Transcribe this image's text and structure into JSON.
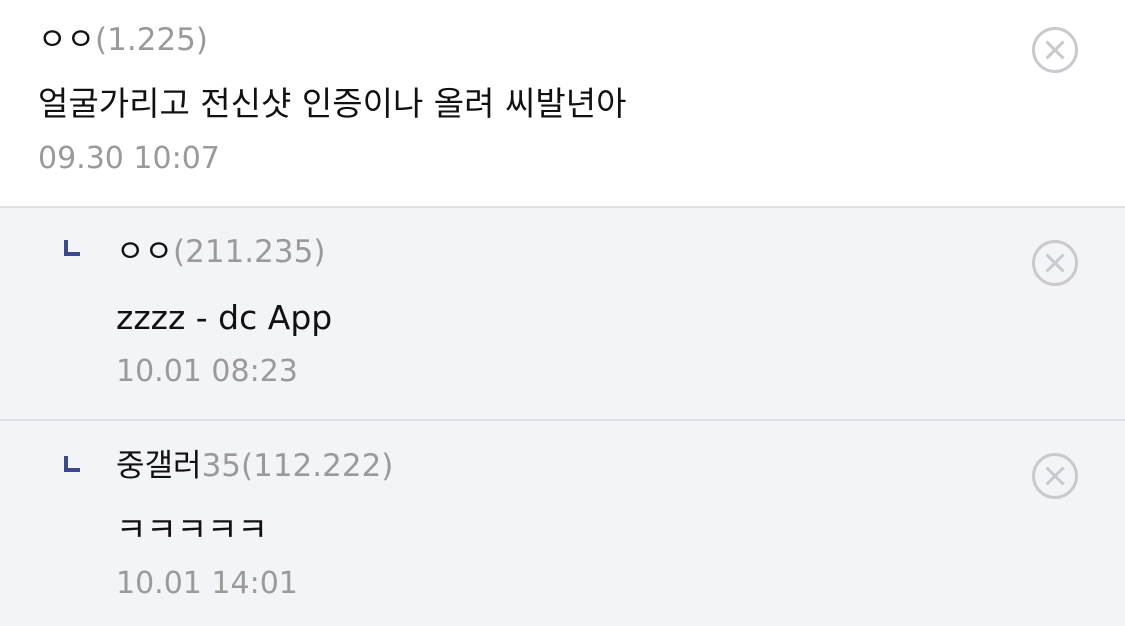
{
  "comments": [
    {
      "nickname": "ㅇㅇ",
      "ip": "(1.225)",
      "text": "얼굴가리고 전신샷 인증이나 올려 씨발년아",
      "date": "09.30 10:07",
      "delete_icon": "close-circle-icon"
    },
    {
      "nickname": "ㅇㅇ",
      "ip": "(211.235)",
      "text": "zzzz - dc App",
      "date": "10.01 08:23",
      "reply_icon": "reply-arrow-icon",
      "delete_icon": "close-circle-icon"
    },
    {
      "nickname": "중갤러",
      "ip": "35(112.222)",
      "text": "ㅋㅋㅋㅋㅋ",
      "date": "10.01 14:01",
      "reply_icon": "reply-arrow-icon",
      "delete_icon": "close-circle-icon"
    }
  ],
  "colors": {
    "reply_background": "#f3f4f8",
    "divider": "#dfe0e7",
    "reply_icon": "#3b4890",
    "secondary_text": "#9a9a9a",
    "delete_icon": "#c9c9ce"
  }
}
